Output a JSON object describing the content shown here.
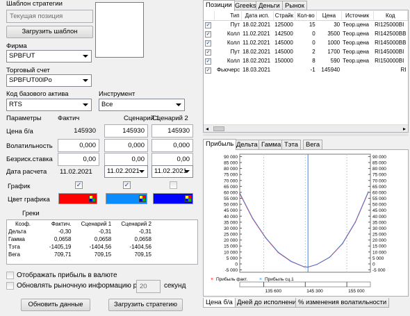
{
  "left": {
    "strategy_template_label": "Шаблон стратегии",
    "current_position_placeholder": "Текущая позиция",
    "load_template_button": "Загрузить шаблон",
    "firm_label": "Фирма",
    "firm_value": "SPBFUT",
    "trade_account_label": "Торговый счет",
    "trade_account_value": "SPBFUT00lPo",
    "base_asset_label": "Код базового актива",
    "base_asset_value": "RTS",
    "instrument_label": "Инструмент",
    "instrument_value": "Все",
    "params": {
      "header_params": "Параметры",
      "header_fact": "Фактич",
      "header_s1": "Сценарий 1",
      "header_s2": "Сценарий 2",
      "price_label": "Цена б/а",
      "price_fact": "145930",
      "price_s1": "145930",
      "price_s2": "145930",
      "vol_label": "Волатильность",
      "vol_fact": "0,000",
      "vol_s1": "0,000",
      "vol_s2": "0,000",
      "rate_label": "Безриск.ставка",
      "rate_fact": "0,00",
      "rate_s1": "0,00",
      "rate_s2": "0,00",
      "date_label": "Дата расчета",
      "date_fact": "11.02.2021",
      "date_s1": "11.02.2021",
      "date_s2": "11.02.2021",
      "chart_label": "График",
      "color_label": "Цвет графика",
      "chart_fact_checked": true,
      "chart_s1_checked": true,
      "chart_s2_checked": false,
      "color_fact": "#ff0000",
      "color_s1": "#0088ff",
      "color_s2": "#0000ff"
    },
    "greeks_title": "Греки",
    "greeks_headers": [
      "Коэф.",
      "Фактич.",
      "Сценарий 1",
      "Сценарий 2"
    ],
    "greeks_rows": [
      [
        "Дельта",
        "-0,30",
        "-0,31",
        "-0,31"
      ],
      [
        "Гамма",
        "0,0658",
        "0,0658",
        "0,0658"
      ],
      [
        "Тэта",
        "-1405,19",
        "-1404,56",
        "-1404,56"
      ],
      [
        "Вега",
        "709,71",
        "709,15",
        "709,15"
      ]
    ],
    "show_profit_currency": "Отображать прибыль в валюте",
    "refresh_market_label": "Обновлять рыночную информацию раз в",
    "refresh_seconds": "20",
    "seconds_label": "секунд",
    "update_data_button": "Обновить данные",
    "load_strategy_button": "Загрузить стратегию"
  },
  "top_tabs": [
    "Позиции",
    "Greeks",
    "Деньги",
    "Рынок"
  ],
  "positions": {
    "headers": [
      "Тип",
      "Дата исп.",
      "Страйк",
      "Кол-во",
      "Цена",
      "Источник",
      "Код"
    ],
    "rows": [
      {
        "checked": true,
        "type": "Пут",
        "date": "18.02.2021",
        "strike": "125000",
        "qty": "15",
        "price": "30",
        "source": "Теор.цена",
        "code": "RI125000BI"
      },
      {
        "checked": true,
        "type": "Колл",
        "date": "11.02.2021",
        "strike": "142500",
        "qty": "0",
        "price": "3500",
        "source": "Теор.цена",
        "code": "RI142500BB"
      },
      {
        "checked": true,
        "type": "Колл",
        "date": "11.02.2021",
        "strike": "145000",
        "qty": "0",
        "price": "1000",
        "source": "Теор.цена",
        "code": "RI145000BB"
      },
      {
        "checked": true,
        "type": "Пут",
        "date": "18.02.2021",
        "strike": "145000",
        "qty": "2",
        "price": "1700",
        "source": "Теор.цена",
        "code": "RI145000BI"
      },
      {
        "checked": true,
        "type": "Колл",
        "date": "18.02.2021",
        "strike": "150000",
        "qty": "8",
        "price": "590",
        "source": "Теор.цена",
        "code": "RI150000BI"
      },
      {
        "checked": true,
        "type": "Фьючерс",
        "date": "18.03.2021",
        "strike": "",
        "qty": "-1",
        "price": "145940",
        "source": "",
        "code": "RI"
      }
    ]
  },
  "chart_tabs": [
    "Прибыль",
    "Дельта",
    "Гамма",
    "Тэта",
    "Вега"
  ],
  "bottom_tabs": [
    "Цена б/а",
    "Дней до исполнения",
    "% изменения волатильности"
  ],
  "chart_data": {
    "type": "line",
    "y_ticks": [
      "90 000",
      "85 000",
      "80 000",
      "75 000",
      "70 000",
      "65 000",
      "60 000",
      "55 000",
      "50 000",
      "45 000",
      "40 000",
      "35 000",
      "30 000",
      "25 000",
      "20 000",
      "15 000",
      "10 000",
      "5 000",
      "0",
      "-5 000"
    ],
    "x_ticks": [
      "135 600",
      "145 300",
      "155 000"
    ],
    "ylim": [
      -7000,
      92000
    ],
    "xlim": [
      130000,
      160500
    ],
    "x_tick_values": [
      135600,
      145300,
      155000
    ],
    "vline_x": 145930,
    "legend_position": "bottom-left",
    "series": [
      {
        "name": "Прибыль факт.",
        "color": "#ff0000",
        "x": [
          130000,
          133000,
          136000,
          139000,
          142000,
          145000,
          145930,
          148000,
          151000,
          154000,
          157000,
          160000
        ],
        "values": [
          59000,
          38000,
          22000,
          9500,
          2000,
          -2500,
          -2700,
          -500,
          5500,
          17000,
          35000,
          60000
        ]
      },
      {
        "name": "Прибыль сц.1",
        "color": "#1e90ff",
        "x": [
          130000,
          133000,
          136000,
          139000,
          142000,
          145000,
          145930,
          148000,
          151000,
          154000,
          157000,
          160000
        ],
        "values": [
          59500,
          38400,
          22300,
          9800,
          2200,
          -2400,
          -2650,
          -400,
          5700,
          17300,
          35400,
          60500
        ]
      }
    ]
  }
}
